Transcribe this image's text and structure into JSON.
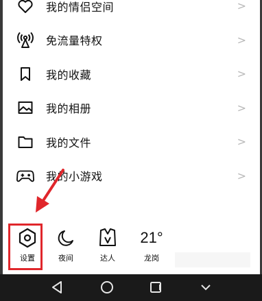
{
  "menu": {
    "items": [
      {
        "label": "我的情侣空间",
        "icon": "heart-icon",
        "chevron": ">"
      },
      {
        "label": "免流量特权",
        "icon": "antenna-icon",
        "chevron": ">"
      },
      {
        "label": "我的收藏",
        "icon": "bookmark-icon",
        "chevron": ">"
      },
      {
        "label": "我的相册",
        "icon": "image-icon",
        "chevron": ">"
      },
      {
        "label": "我的文件",
        "icon": "folder-icon",
        "chevron": ">"
      },
      {
        "label": "我的小游戏",
        "icon": "gamepad-icon",
        "chevron": ">"
      }
    ]
  },
  "toolbar": {
    "settings_label": "设置",
    "night_label": "夜间",
    "star_label": "达人",
    "temperature": "21°",
    "city": "龙岗"
  },
  "colors": {
    "highlight": "#e0262b",
    "navbar": "#1a1a1a"
  }
}
